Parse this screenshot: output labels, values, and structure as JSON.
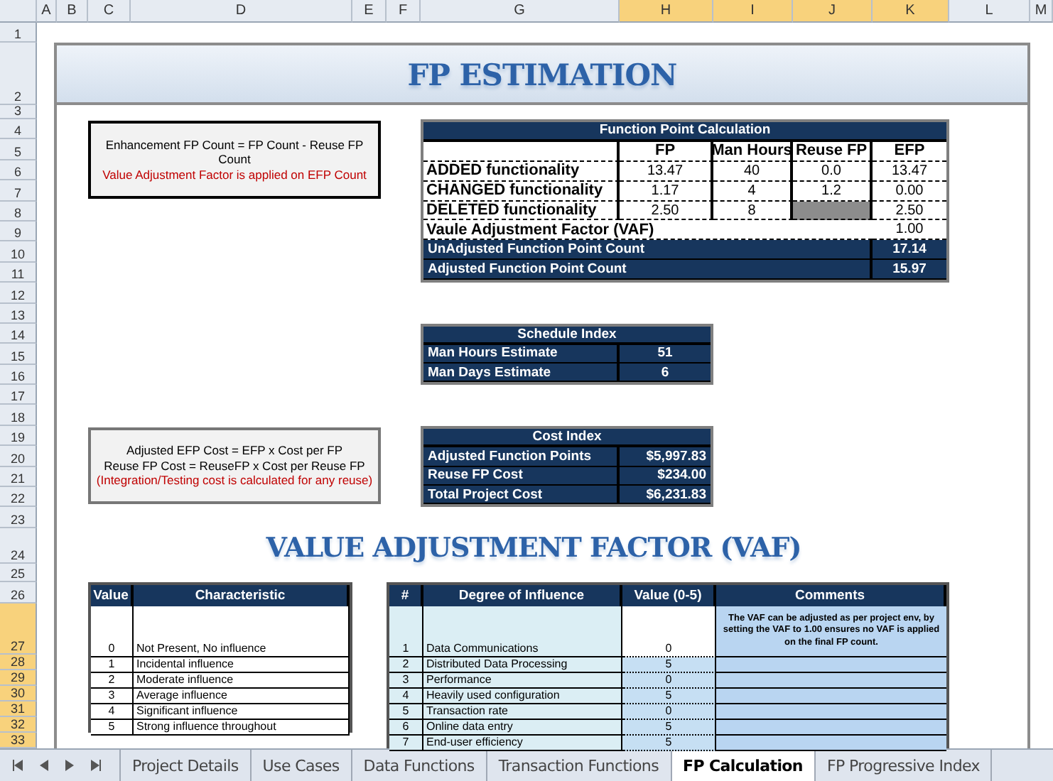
{
  "column_headers": [
    {
      "label": "A",
      "selected": false
    },
    {
      "label": "B",
      "selected": false
    },
    {
      "label": "C",
      "selected": false
    },
    {
      "label": "D",
      "selected": false
    },
    {
      "label": "E",
      "selected": false
    },
    {
      "label": "F",
      "selected": false
    },
    {
      "label": "G",
      "selected": false
    },
    {
      "label": "H",
      "selected": true
    },
    {
      "label": "I",
      "selected": true
    },
    {
      "label": "J",
      "selected": true
    },
    {
      "label": "K",
      "selected": true
    },
    {
      "label": "L",
      "selected": false
    },
    {
      "label": "M",
      "selected": false
    }
  ],
  "row_headers": [
    {
      "label": "1",
      "selected": false
    },
    {
      "label": "2",
      "selected": false
    },
    {
      "label": "3",
      "selected": false
    },
    {
      "label": "4",
      "selected": false
    },
    {
      "label": "5",
      "selected": false
    },
    {
      "label": "6",
      "selected": false
    },
    {
      "label": "7",
      "selected": false
    },
    {
      "label": "8",
      "selected": false
    },
    {
      "label": "9",
      "selected": false
    },
    {
      "label": "10",
      "selected": false
    },
    {
      "label": "11",
      "selected": false
    },
    {
      "label": "12",
      "selected": false
    },
    {
      "label": "13",
      "selected": false
    },
    {
      "label": "14",
      "selected": false
    },
    {
      "label": "15",
      "selected": false
    },
    {
      "label": "16",
      "selected": false
    },
    {
      "label": "17",
      "selected": false
    },
    {
      "label": "18",
      "selected": false
    },
    {
      "label": "19",
      "selected": false
    },
    {
      "label": "20",
      "selected": false
    },
    {
      "label": "21",
      "selected": false
    },
    {
      "label": "22",
      "selected": false
    },
    {
      "label": "23",
      "selected": false
    },
    {
      "label": "24",
      "selected": false
    },
    {
      "label": "25",
      "selected": false
    },
    {
      "label": "26",
      "selected": false
    },
    {
      "label": "27",
      "selected": true
    },
    {
      "label": "28",
      "selected": true
    },
    {
      "label": "29",
      "selected": true
    },
    {
      "label": "30",
      "selected": true
    },
    {
      "label": "31",
      "selected": true
    },
    {
      "label": "32",
      "selected": true
    },
    {
      "label": "33",
      "selected": true
    }
  ],
  "title": "FP ESTIMATION",
  "notes": [
    {
      "lines": [
        {
          "text": "Enhancement FP Count =  FP Count - Reuse FP Count",
          "kind": "formula"
        },
        {
          "text": "Value Adjustment Factor is applied on EFP Count",
          "kind": "warning"
        }
      ]
    },
    {
      "lines": [
        {
          "text": "Adjusted EFP Cost = EFP x Cost per FP",
          "kind": "formula"
        },
        {
          "text": "Reuse FP Cost = ReuseFP x Cost per Reuse FP",
          "kind": "formula"
        },
        {
          "text": "(Integration/Testing cost is calculated for any reuse)",
          "kind": "warning"
        }
      ]
    }
  ],
  "fp_calculation": {
    "title": "Function Point Calculation",
    "columns": [
      "FP",
      "Man Hours",
      "Reuse FP",
      "EFP"
    ],
    "rows": [
      {
        "label": "ADDED functionality",
        "fp": "13.47",
        "man_hours": "40",
        "reuse_fp": "0.0",
        "efp": "13.47",
        "reuse_disabled": false
      },
      {
        "label": "CHANGED functionality",
        "fp": "1.17",
        "man_hours": "4",
        "reuse_fp": "1.2",
        "efp": "0.00",
        "reuse_disabled": false
      },
      {
        "label": "DELETED functionality",
        "fp": "2.50",
        "man_hours": "8",
        "efp": "2.50",
        "reuse_disabled": true
      }
    ],
    "vaf": {
      "label": "Vaule Adjustment Factor (VAF)",
      "value": "1.00"
    },
    "totals": [
      {
        "label": "UnAdjusted Function Point Count",
        "value": "17.14"
      },
      {
        "label": "Adjusted Function Point Count",
        "value": "15.97"
      }
    ]
  },
  "schedule_index": {
    "title": "Schedule Index",
    "rows": [
      {
        "label": "Man Hours Estimate",
        "value": "51"
      },
      {
        "label": "Man Days Estimate",
        "value": "6"
      }
    ]
  },
  "cost_index": {
    "title": "Cost Index",
    "rows": [
      {
        "label": "Adjusted Function Points",
        "value": "$5,997.83"
      },
      {
        "label": "Reuse FP Cost",
        "value": "$234.00"
      },
      {
        "label": "Total Project Cost",
        "value": "$6,231.83"
      }
    ]
  },
  "vaf_title": "VALUE ADJUSTMENT FACTOR (VAF)",
  "characteristics": {
    "columns": [
      "Value",
      "Characteristic"
    ],
    "rows": [
      {
        "value": "0",
        "label": "Not Present, No influence"
      },
      {
        "value": "1",
        "label": "Incidental influence"
      },
      {
        "value": "2",
        "label": "Moderate influence"
      },
      {
        "value": "3",
        "label": "Average influence"
      },
      {
        "value": "4",
        "label": "Significant influence"
      },
      {
        "value": "5",
        "label": "Strong influence throughout"
      }
    ]
  },
  "influence": {
    "columns": [
      "#",
      "Degree of Influence",
      "Value (0-5)",
      "Comments"
    ],
    "comment": "The VAF can be adjusted as per project env, by setting the VAF to 1.00 ensures no VAF is applied on the final FP count.",
    "rows": [
      {
        "number": "1",
        "label": "Data Communications",
        "value": "0"
      },
      {
        "number": "2",
        "label": "Distributed Data Processing",
        "value": "5"
      },
      {
        "number": "3",
        "label": "Performance",
        "value": "0"
      },
      {
        "number": "4",
        "label": "Heavily used configuration",
        "value": "5"
      },
      {
        "number": "5",
        "label": "Transaction rate",
        "value": "0"
      },
      {
        "number": "6",
        "label": "Online data entry",
        "value": "5"
      },
      {
        "number": "7",
        "label": "End-user efficiency",
        "value": "5"
      }
    ]
  },
  "sheet_tabs": [
    {
      "label": "Project Details",
      "selected": false
    },
    {
      "label": "Use Cases",
      "selected": false
    },
    {
      "label": "Data Functions",
      "selected": false
    },
    {
      "label": "Transaction Functions",
      "selected": false
    },
    {
      "label": "FP Calculation",
      "selected": true
    },
    {
      "label": "FP Progressive Index",
      "selected": false
    }
  ]
}
